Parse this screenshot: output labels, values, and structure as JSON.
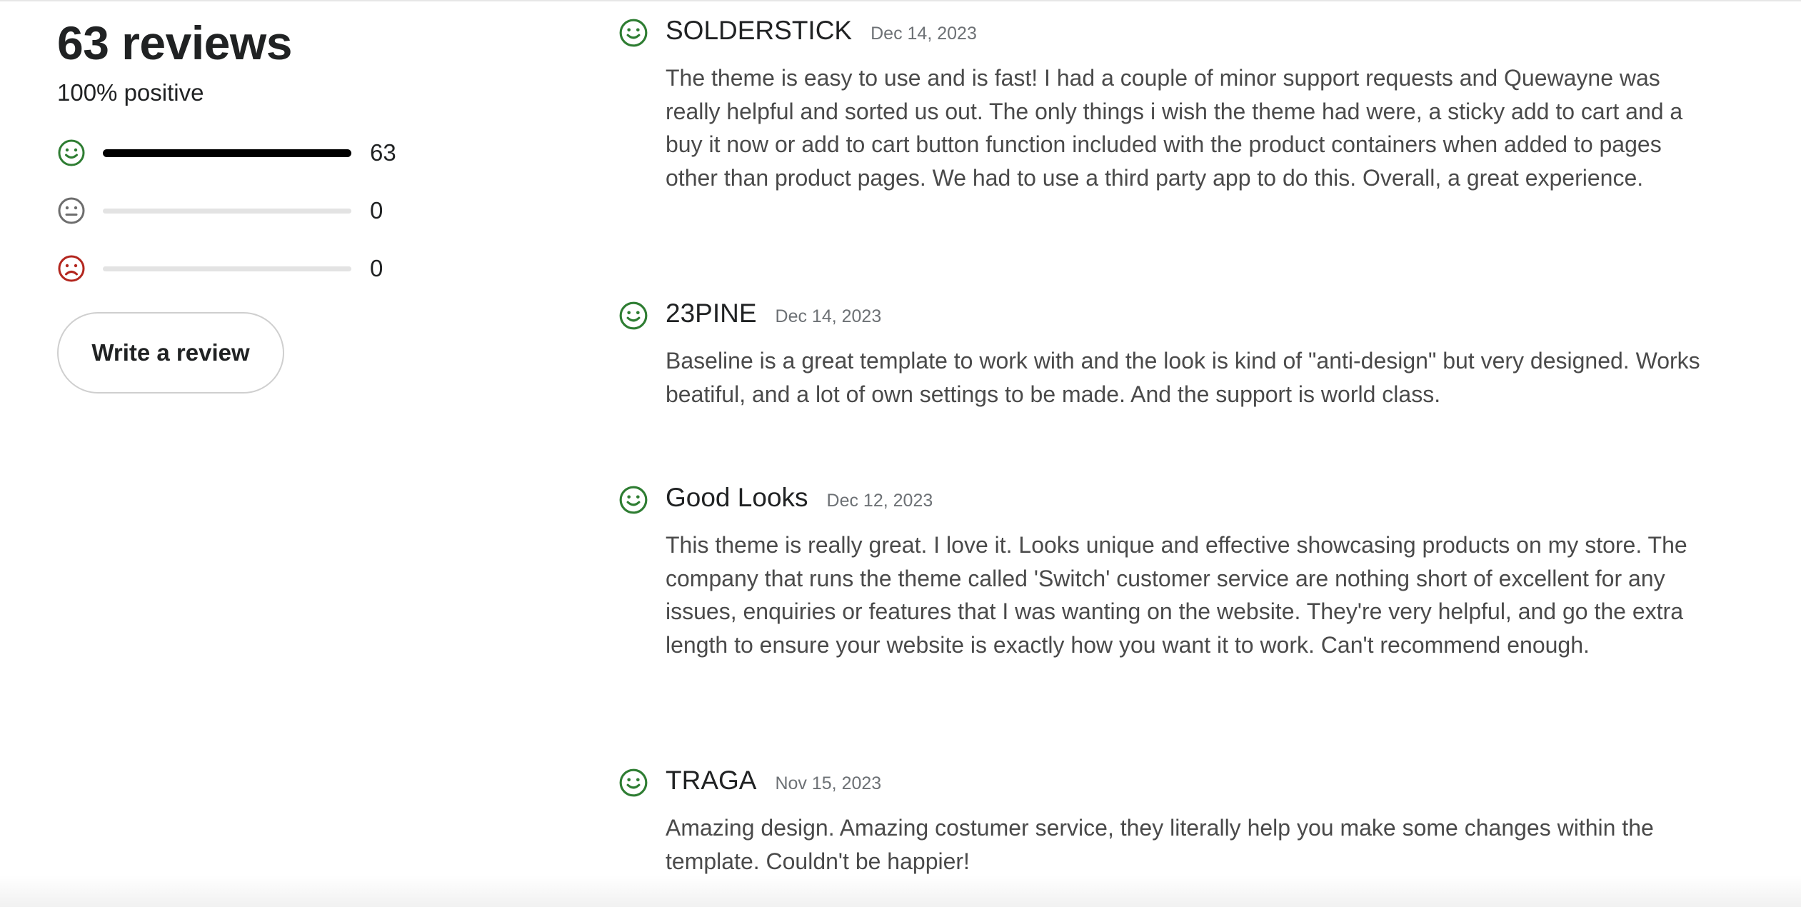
{
  "summary": {
    "title": "63 reviews",
    "subtitle": "100% positive",
    "distribution": [
      {
        "sentiment": "positive",
        "icon": "smile-icon",
        "color": "#2e7d32",
        "count": "63",
        "fraction": 1.0
      },
      {
        "sentiment": "neutral",
        "icon": "neutral-face-icon",
        "color": "#6d6d6d",
        "count": "0",
        "fraction": 0.0
      },
      {
        "sentiment": "negative",
        "icon": "frown-icon",
        "color": "#b3261e",
        "count": "0",
        "fraction": 0.0
      }
    ],
    "write_review_label": "Write a review"
  },
  "reviews": [
    {
      "author": "SOLDERSTICK",
      "date": "Dec 14, 2023",
      "sentiment": "positive",
      "icon": "smile-icon",
      "text": "The theme is easy to use and is fast! I had a couple of minor support requests and Quewayne was really helpful and sorted us out. The only things i wish the theme had were, a sticky add to cart and a buy it now or add to cart button function included with the product containers when added to pages other than product pages. We had to use a third party app to do this. Overall, a great experience."
    },
    {
      "author": "23PINE",
      "date": "Dec 14, 2023",
      "sentiment": "positive",
      "icon": "smile-icon",
      "text": "Baseline is a great template to work with and the look is kind of \"anti-design\" but very designed. Works beatiful, and a lot of own settings to be made. And the support is world class."
    },
    {
      "author": "Good Looks",
      "date": "Dec 12, 2023",
      "sentiment": "positive",
      "icon": "smile-icon",
      "text": "This theme is really great. I love it. Looks unique and effective showcasing products on my store. The company that runs the theme called 'Switch' customer service are nothing short of excellent for any issues, enquiries or features that I was wanting on the website. They're very helpful, and go the extra length to ensure your website is exactly how you want it to work. Can't recommend enough."
    },
    {
      "author": "TRAGA",
      "date": "Nov 15, 2023",
      "sentiment": "positive",
      "icon": "smile-icon",
      "text": "Amazing design. Amazing costumer service, they literally help you make some changes within the template. Couldn't be happier!"
    }
  ],
  "colors": {
    "positive": "#2e7d32",
    "neutral": "#6d6d6d",
    "negative": "#b3261e",
    "bar_fill": "#000000",
    "bar_track": "#e3e3e3"
  }
}
